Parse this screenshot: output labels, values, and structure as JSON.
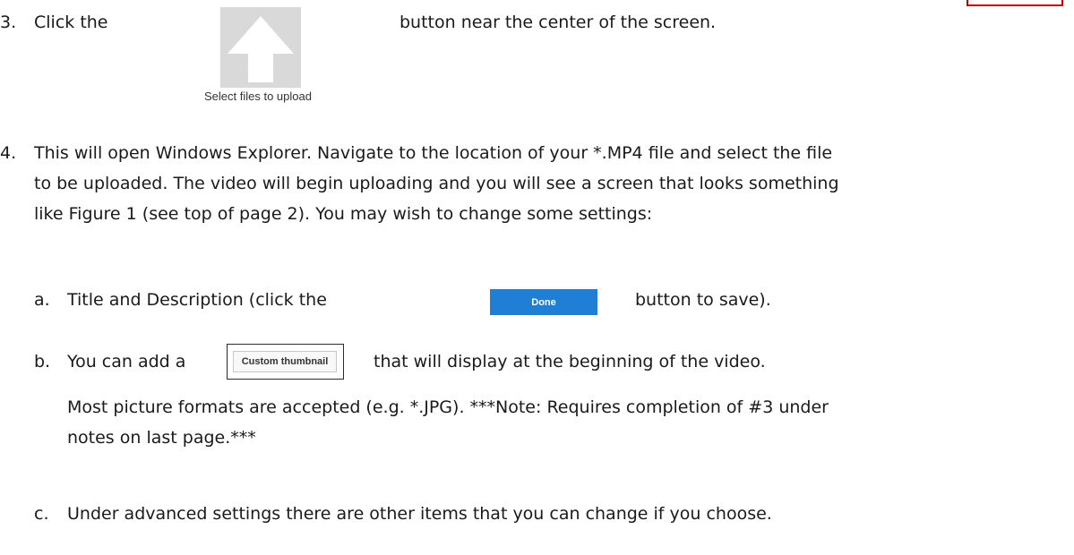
{
  "step3": {
    "number": "3.",
    "before": "Click  the",
    "after": "button near the center of the screen.",
    "upload_caption": "Select files to upload"
  },
  "step4": {
    "number": "4.",
    "lines": [
      "This will open Windows Explorer.  Navigate to the location of your *.MP4 file and select the file",
      "to be uploaded.  The video will begin uploading and you will see a screen that looks something",
      "like Figure 1 (see top of page 2).  You may wish to change some settings:"
    ]
  },
  "item_a": {
    "letter": "a.",
    "before": "Title and Description (click the",
    "button_label": "Done",
    "after": "button to save)."
  },
  "item_b": {
    "letter": "b.",
    "before": "You can add a",
    "button_label": "Custom thumbnail",
    "after": "that will display at the beginning of the video.",
    "lines": [
      "Most picture formats are accepted (e.g. *.JPG).   ***Note:  Requires completion of #3 under",
      "notes on last page.***"
    ]
  },
  "item_c": {
    "letter": "c.",
    "text": "Under advanced settings there are other items that you can change if you choose."
  },
  "colors": {
    "done_button": "#1f7fd4",
    "upload_tile": "#d9d9d9",
    "corner_box": "#c00000"
  },
  "icons": {
    "upload": "upload-arrow-icon"
  }
}
